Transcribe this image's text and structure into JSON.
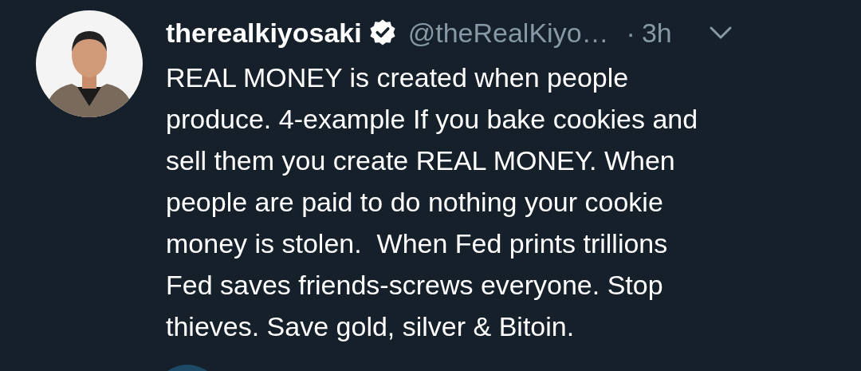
{
  "tweet": {
    "display_name": "therealkiyosaki",
    "verified": true,
    "handle": "@theRealKiyo…",
    "separator": "·",
    "time": "3h",
    "text": "REAL MONEY is created when people\nproduce. 4-example If you bake cookies and\nsell them you create REAL MONEY. When\npeople are paid to do nothing your cookie\nmoney is stolen.  When Fed prints trillions\nFed saves friends-screws everyone. Stop\nthieves. Save gold, silver & Bitoin."
  }
}
